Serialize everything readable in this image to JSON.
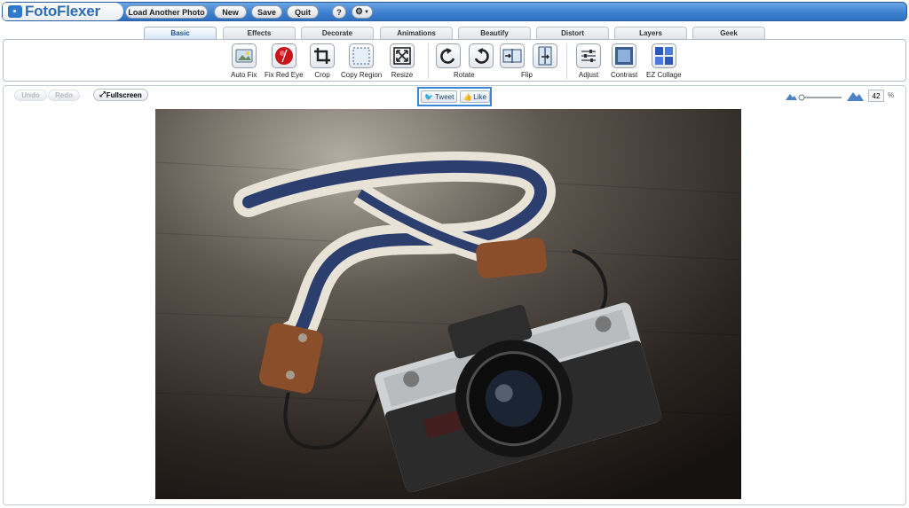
{
  "app": {
    "name": "FotoFlexer"
  },
  "topbar": {
    "load_label": "Load Another Photo",
    "new_label": "New",
    "save_label": "Save",
    "quit_label": "Quit",
    "help_label": "?"
  },
  "tabs": [
    {
      "label": "Basic",
      "active": true
    },
    {
      "label": "Effects"
    },
    {
      "label": "Decorate"
    },
    {
      "label": "Animations"
    },
    {
      "label": "Beautify"
    },
    {
      "label": "Distort"
    },
    {
      "label": "Layers"
    },
    {
      "label": "Geek"
    }
  ],
  "tools": {
    "auto_fix": "Auto Fix",
    "fix_red_eye": "Fix Red Eye",
    "crop": "Crop",
    "copy_region": "Copy Region",
    "resize": "Resize",
    "rotate": "Rotate",
    "flip": "Flip",
    "adjust": "Adjust",
    "contrast": "Contrast",
    "ez_collage": "EZ Collage"
  },
  "workspace": {
    "undo_label": "Undo",
    "redo_label": "Redo",
    "fullscreen_label": "Fullscreen",
    "tweet_label": "Tweet",
    "like_label": "Like",
    "zoom_value": "42",
    "zoom_unit": "%"
  },
  "colors": {
    "brand_blue": "#3d7fcf",
    "share_border": "#3a86d6"
  }
}
